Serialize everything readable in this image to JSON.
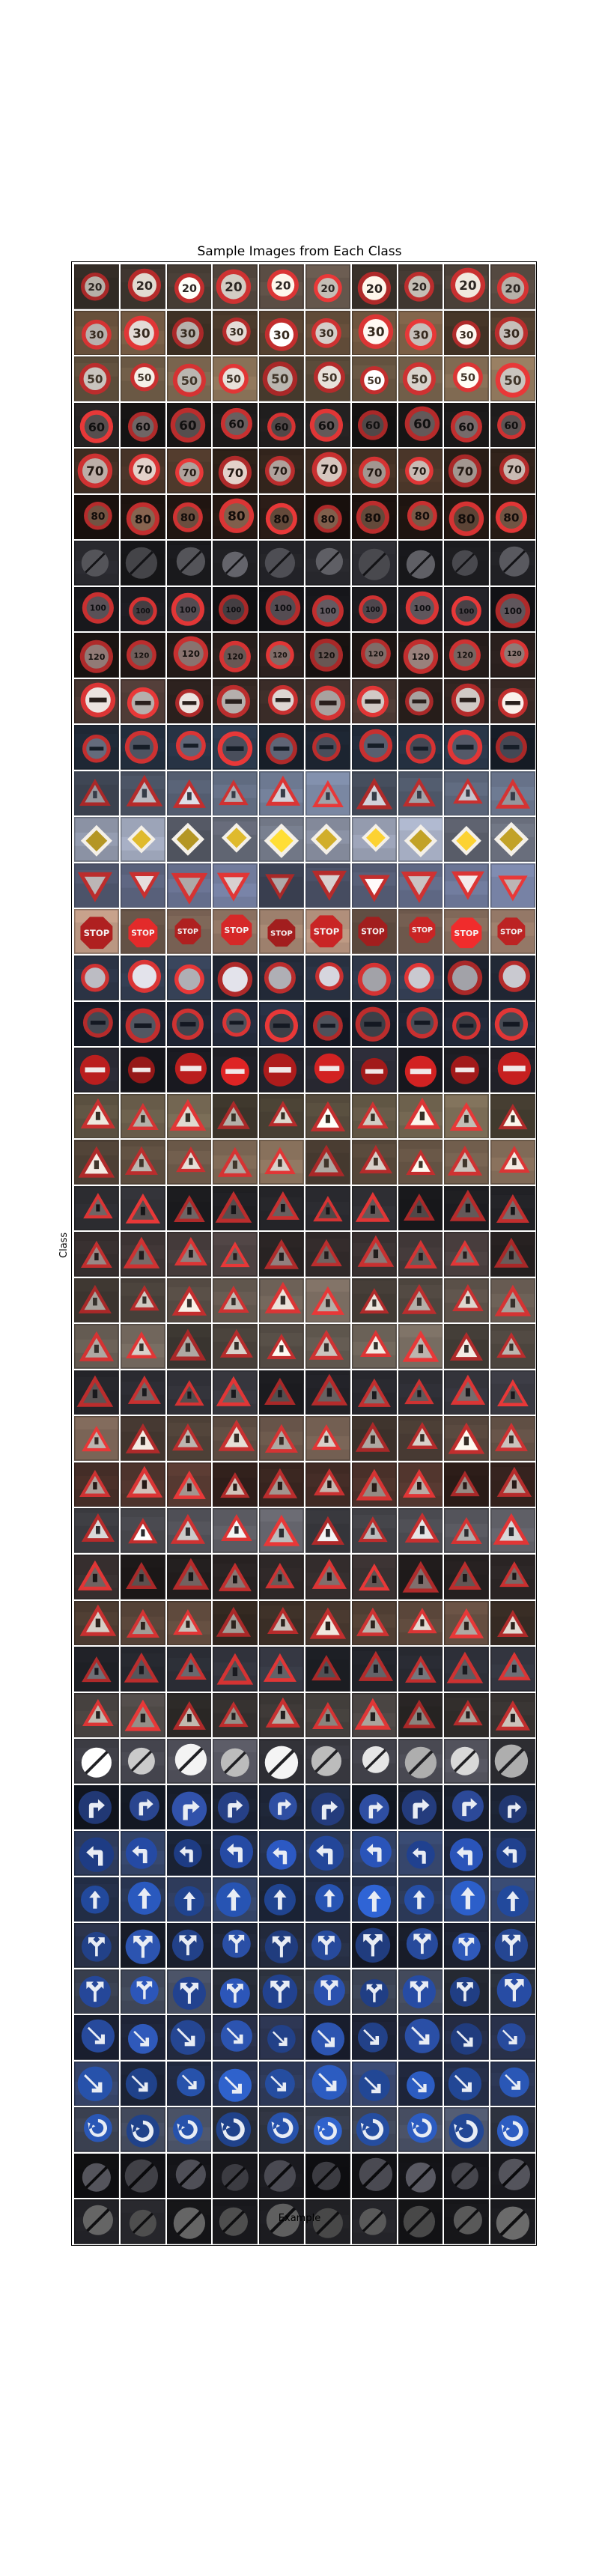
{
  "title": "Sample Images from Each Class",
  "xlabel": "Example",
  "ylabel": "Class",
  "grid": {
    "columns": 10
  },
  "rows": [
    {
      "sign": "circle-red",
      "text": "20",
      "bg": "#4a4038",
      "fg": "#f2eae0"
    },
    {
      "sign": "circle-red",
      "text": "30",
      "bg": "#5a4634",
      "fg": "#f4ece6"
    },
    {
      "sign": "circle-red",
      "text": "50",
      "bg": "#6a5844",
      "fg": "#f8f2ea"
    },
    {
      "sign": "circle-red",
      "text": "60",
      "bg": "#1c1a1a",
      "fg": "#6a6060"
    },
    {
      "sign": "circle-red",
      "text": "70",
      "bg": "#3a2a20",
      "fg": "#d8c8c0"
    },
    {
      "sign": "circle-red",
      "text": "80",
      "bg": "#1e1410",
      "fg": "#7a5a48"
    },
    {
      "sign": "circle-gray",
      "text": "",
      "bg": "#202024",
      "fg": "#5a5a60"
    },
    {
      "sign": "circle-red",
      "text": "100",
      "bg": "#18181c",
      "fg": "#5a5258"
    },
    {
      "sign": "circle-red",
      "text": "120",
      "bg": "#221a18",
      "fg": "#8a7470"
    },
    {
      "sign": "circle-red",
      "text": "",
      "bg": "#3a2c28",
      "fg": "#e0d8d4"
    },
    {
      "sign": "circle-red",
      "text": "",
      "bg": "#202a38",
      "fg": "#5a6070"
    },
    {
      "sign": "triangle",
      "text": "",
      "bg": "#5a6478",
      "fg": "#c8c8d0"
    },
    {
      "sign": "diamond",
      "text": "",
      "bg": "#7a8090",
      "fg": "#f0c830"
    },
    {
      "sign": "yield",
      "text": "",
      "bg": "#58607a",
      "fg": "#e8e0e0"
    },
    {
      "sign": "octagon",
      "text": "STOP",
      "bg": "#8a7060",
      "fg": "#d82828"
    },
    {
      "sign": "circle-ring",
      "text": "",
      "bg": "#283040",
      "fg": "#d8d8e0"
    },
    {
      "sign": "circle-red",
      "text": "",
      "bg": "#1c2230",
      "fg": "#4a4e58"
    },
    {
      "sign": "no-entry",
      "text": "",
      "bg": "#202028",
      "fg": "#c82020"
    },
    {
      "sign": "triangle",
      "text": "",
      "bg": "#5a5040",
      "fg": "#f0eae0"
    },
    {
      "sign": "triangle",
      "text": "",
      "bg": "#6a5848",
      "fg": "#e8e0d8"
    },
    {
      "sign": "triangle",
      "text": "",
      "bg": "#242428",
      "fg": "#6a6060"
    },
    {
      "sign": "triangle",
      "text": "",
      "bg": "#383030",
      "fg": "#8a7a78"
    },
    {
      "sign": "triangle",
      "text": "",
      "bg": "#5a5048",
      "fg": "#e0d8d0"
    },
    {
      "sign": "triangle",
      "text": "",
      "bg": "#585048",
      "fg": "#e8e0d8"
    },
    {
      "sign": "triangle",
      "text": "",
      "bg": "#2a2a30",
      "fg": "#706868"
    },
    {
      "sign": "triangle",
      "text": "",
      "bg": "#5a4a40",
      "fg": "#e8e0d8"
    },
    {
      "sign": "triangle",
      "text": "",
      "bg": "#402a24",
      "fg": "#c8b8b0"
    },
    {
      "sign": "triangle",
      "text": "",
      "bg": "#4a4a50",
      "fg": "#e8e8e8"
    },
    {
      "sign": "triangle",
      "text": "",
      "bg": "#2a2424",
      "fg": "#7a6a68"
    },
    {
      "sign": "triangle",
      "text": "",
      "bg": "#4a3a30",
      "fg": "#d8d0c8"
    },
    {
      "sign": "triangle",
      "text": "",
      "bg": "#2a2c34",
      "fg": "#6a6a70"
    },
    {
      "sign": "triangle",
      "text": "",
      "bg": "#3a3634",
      "fg": "#b8b0a8"
    },
    {
      "sign": "circle-end",
      "text": "",
      "bg": "#404048",
      "fg": "#e8e8e8"
    },
    {
      "sign": "blue-right",
      "text": "",
      "bg": "#181e2c",
      "fg": "#2c4a9a"
    },
    {
      "sign": "blue-left",
      "text": "",
      "bg": "#283450",
      "fg": "#2850b0"
    },
    {
      "sign": "blue-up",
      "text": "",
      "bg": "#283450",
      "fg": "#2a5ac0"
    },
    {
      "sign": "blue-split",
      "text": "",
      "bg": "#1e2434",
      "fg": "#2a50a8"
    },
    {
      "sign": "blue-split",
      "text": "",
      "bg": "#343a48",
      "fg": "#2a52b0"
    },
    {
      "sign": "blue-down",
      "text": "",
      "bg": "#20263a",
      "fg": "#2a50a8"
    },
    {
      "sign": "blue-down",
      "text": "",
      "bg": "#2a3450",
      "fg": "#2a58b8"
    },
    {
      "sign": "blue-round",
      "text": "",
      "bg": "#3a4050",
      "fg": "#2a58b8"
    },
    {
      "sign": "circle-end",
      "text": "",
      "bg": "#141418",
      "fg": "#505058"
    },
    {
      "sign": "circle-end",
      "text": "",
      "bg": "#1c1c20",
      "fg": "#606060"
    }
  ]
}
